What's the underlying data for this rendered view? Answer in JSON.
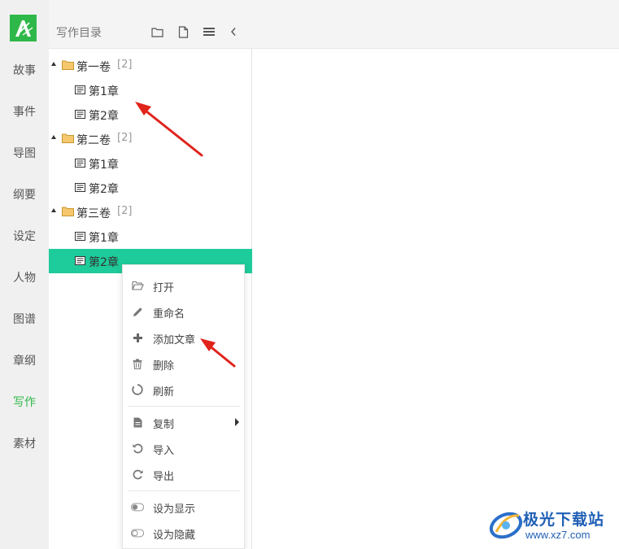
{
  "rail": {
    "items": [
      {
        "label": "故事"
      },
      {
        "label": "事件"
      },
      {
        "label": "导图"
      },
      {
        "label": "纲要"
      },
      {
        "label": "设定"
      },
      {
        "label": "人物"
      },
      {
        "label": "图谱"
      },
      {
        "label": "章纲"
      },
      {
        "label": "写作",
        "active": true
      },
      {
        "label": "素材"
      }
    ],
    "logo_color": "#2fb84a"
  },
  "panel": {
    "title": "写作目录",
    "header_icons": [
      "folder-icon",
      "file-icon",
      "menu-icon",
      "collapse-icon"
    ]
  },
  "tree": {
    "volumes": [
      {
        "label": "第一卷",
        "count": "[2]",
        "chapters": [
          "第1章",
          "第2章"
        ]
      },
      {
        "label": "第二卷",
        "count": "[2]",
        "chapters": [
          "第1章",
          "第2章"
        ]
      },
      {
        "label": "第三卷",
        "count": "[2]",
        "chapters": [
          "第1章",
          "第2章"
        ]
      }
    ],
    "selected": "第三卷/第2章",
    "selected_color": "#1ecb9a"
  },
  "context_menu": {
    "items": [
      {
        "label": "打开",
        "icon": "folder-open-icon"
      },
      {
        "label": "重命名",
        "icon": "pencil-icon"
      },
      {
        "label": "添加文章",
        "icon": "plus-icon"
      },
      {
        "label": "删除",
        "icon": "trash-icon"
      },
      {
        "label": "刷新",
        "icon": "refresh-icon"
      },
      {
        "label": "复制",
        "icon": "copy-doc-icon",
        "submenu": true
      },
      {
        "label": "导入",
        "icon": "import-icon"
      },
      {
        "label": "导出",
        "icon": "export-icon"
      },
      {
        "label": "设为显示",
        "icon": "toggle-on-icon"
      },
      {
        "label": "设为隐藏",
        "icon": "toggle-off-icon"
      }
    ]
  },
  "watermark": {
    "title": "极光下载站",
    "url": "www.xz7.com"
  },
  "annotation_color": "#e0231b"
}
